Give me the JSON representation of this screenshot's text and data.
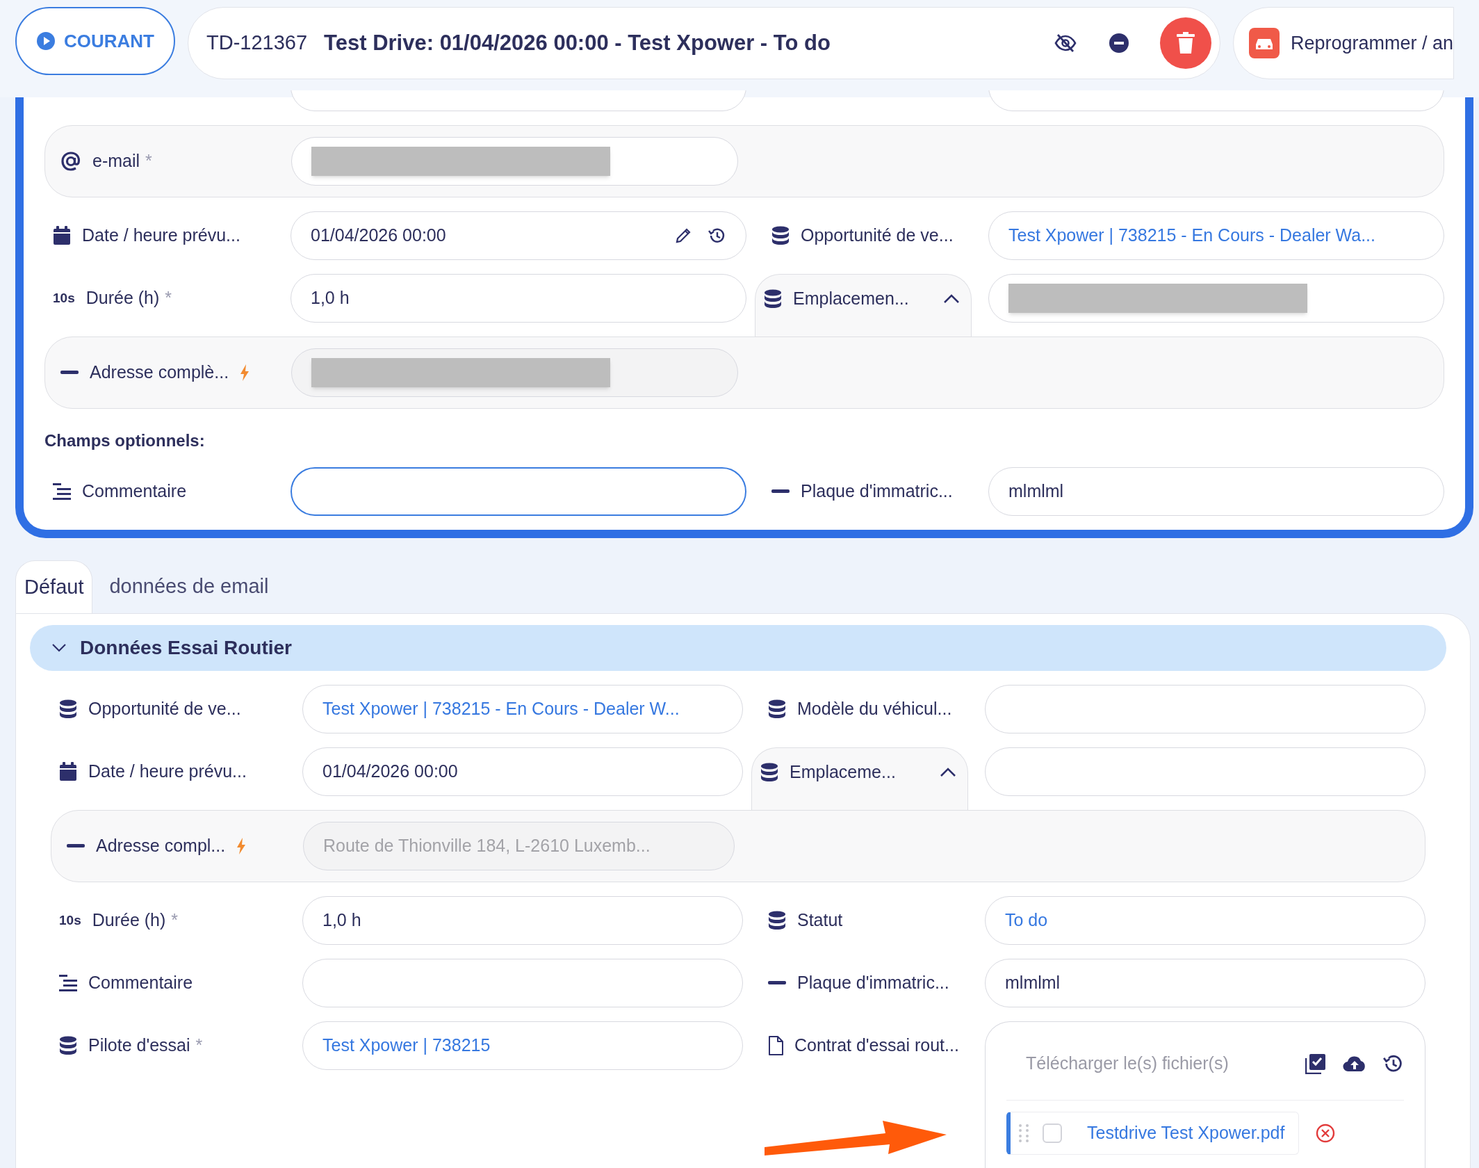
{
  "header": {
    "status_button": "COURANT",
    "record_id": "TD-121367",
    "title": "Test Drive: 01/04/2026 00:00 - Test Xpower - To do",
    "reschedule_button": "Reprogrammer / an"
  },
  "main_card": {
    "rows": [
      {
        "kind": "clipped"
      },
      {
        "kind": "panel",
        "cells": [
          {
            "kind": "email",
            "label": "e-mail",
            "required_mark": "*",
            "redacted": true
          }
        ]
      },
      {
        "kind": "pair",
        "cells": [
          {
            "kind": "datetime",
            "label": "Date / heure prévu...",
            "value": "01/04/2026 00:00",
            "actions": true
          },
          {
            "kind": "lookup",
            "label": "Opportunité de ve...",
            "value": "Test Xpower | 738215 - En Cours - Dealer Wa..."
          }
        ]
      },
      {
        "kind": "pair",
        "cells": [
          {
            "kind": "duration",
            "icon_text": "10s",
            "label": "Durée (h)",
            "required_mark": "*",
            "value": "1,0 h"
          },
          {
            "kind": "lookup",
            "label": "Emplacemen...",
            "expanded": true,
            "redacted": true
          }
        ]
      },
      {
        "kind": "panel",
        "cells": [
          {
            "kind": "address",
            "label": "Adresse complè...",
            "disabled": true,
            "redacted": true
          }
        ]
      },
      {
        "kind": "heading",
        "text": "Champs optionnels:"
      },
      {
        "kind": "pair",
        "cells": [
          {
            "kind": "memo",
            "label": "Commentaire",
            "focused": true
          },
          {
            "kind": "text",
            "label": "Plaque d'immatric...",
            "value": "mlmlml"
          }
        ]
      }
    ]
  },
  "tabs": [
    {
      "label": "Défaut",
      "selected": true
    },
    {
      "label": "données de email",
      "selected": false
    }
  ],
  "section": {
    "title": "Données Essai Routier",
    "expanded": true,
    "rows": [
      {
        "kind": "pair",
        "cells": [
          {
            "kind": "lookup",
            "label": "Opportunité de ve...",
            "value": "Test Xpower | 738215 - En Cours - Dealer W..."
          },
          {
            "kind": "lookup",
            "label": "Modèle du véhicul..."
          }
        ]
      },
      {
        "kind": "pair",
        "cells": [
          {
            "kind": "datetime",
            "label": "Date / heure prévu...",
            "value": "01/04/2026 00:00"
          },
          {
            "kind": "lookup",
            "label": "Emplaceme...",
            "expanded": true
          }
        ]
      },
      {
        "kind": "panel",
        "cells": [
          {
            "kind": "address",
            "label": "Adresse compl...",
            "disabled": true,
            "value": "Route de Thionville 184, L-2610 Luxemb..."
          }
        ]
      },
      {
        "kind": "pair",
        "cells": [
          {
            "kind": "duration",
            "icon_text": "10s",
            "label": "Durée (h)",
            "required_mark": "*",
            "value": "1,0 h"
          },
          {
            "kind": "lookup",
            "label": "Statut",
            "value": "To do"
          }
        ]
      },
      {
        "kind": "pair",
        "cells": [
          {
            "kind": "memo",
            "label": "Commentaire"
          },
          {
            "kind": "text",
            "label": "Plaque d'immatric...",
            "value": "mlmlml"
          }
        ]
      },
      {
        "kind": "pair",
        "cells": [
          {
            "kind": "lookup",
            "label": "Pilote d'essai",
            "required_mark": "*",
            "value": "Test Xpower | 738215"
          },
          {
            "kind": "file",
            "label": "Contrat d'essai rout...",
            "placeholder": "Télécharger le(s) fichier(s)",
            "files": [
              {
                "name": "Testdrive Test Xpower.pdf",
                "checked": false
              }
            ]
          }
        ]
      }
    ]
  }
}
